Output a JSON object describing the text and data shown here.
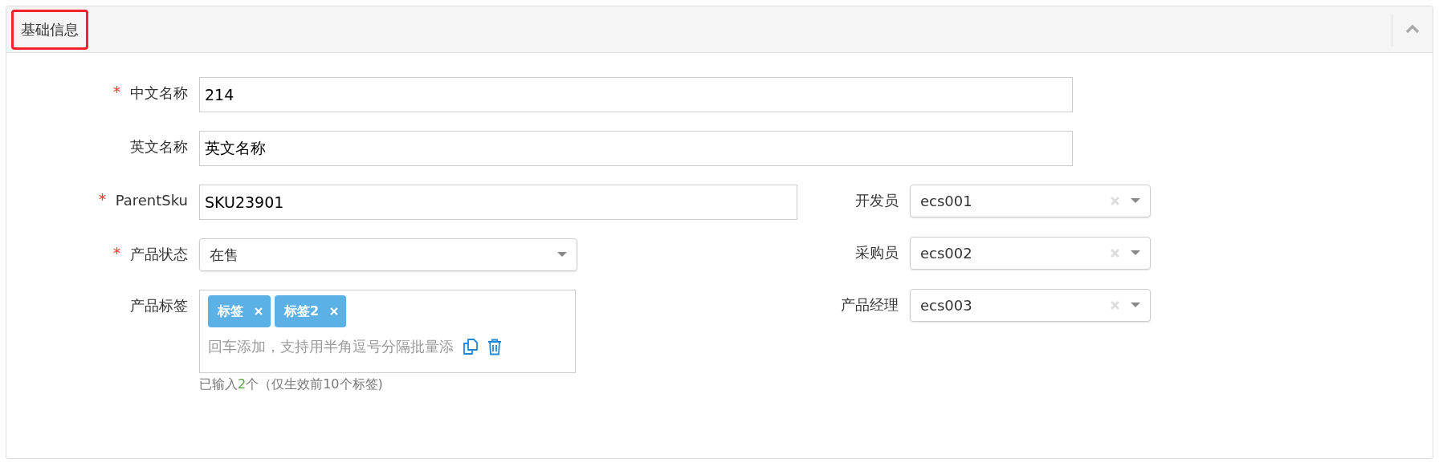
{
  "section": {
    "title": "基础信息",
    "highlighted": true,
    "expanded": true
  },
  "wide_fields": [
    {
      "kind": "text",
      "label": "中文名称",
      "required": true,
      "value": "214"
    },
    {
      "kind": "text",
      "label": "英文名称",
      "required": false,
      "value": "英文名称"
    }
  ],
  "left_fields": [
    {
      "kind": "text",
      "label": "ParentSku",
      "required": true,
      "value": "SKU23901"
    },
    {
      "kind": "select",
      "label": "产品状态",
      "required": true,
      "value": "在售",
      "clearable": false
    },
    {
      "kind": "tags",
      "label": "产品标签",
      "required": false,
      "tags": [
        "标签",
        "标签2"
      ],
      "placeholder": "回车添加，支持用半角逗号分隔批量添",
      "hint": {
        "before": "已输入",
        "count": "2",
        "after": "个（仅生效前10个标签)"
      }
    }
  ],
  "right_fields": [
    {
      "kind": "select",
      "label": "开发员",
      "required": false,
      "value": "ecs001",
      "clearable": true
    },
    {
      "kind": "select",
      "label": "采购员",
      "required": false,
      "value": "ecs002",
      "clearable": true
    },
    {
      "kind": "select",
      "label": "产品经理",
      "required": false,
      "value": "ecs003",
      "clearable": true
    }
  ]
}
